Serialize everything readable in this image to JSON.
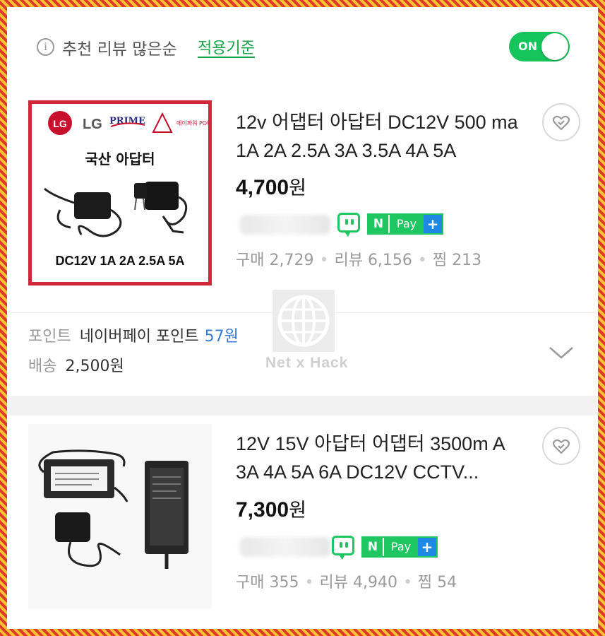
{
  "filter": {
    "info_icon": "info-icon",
    "sort_label": "추천 리뷰 많은순",
    "criteria_link": "적용기준",
    "toggle_label": "ON",
    "toggle_on": true
  },
  "products": [
    {
      "title": "12v 어댑터 아답터 DC12V 500 ma 1A 2A 2.5A 3A 3.5A 4A 5A",
      "price": "4,700",
      "currency": "원",
      "badges": {
        "npay_n": "N",
        "npay_pay": "Pay",
        "npay_plus": "+"
      },
      "stats": {
        "purchase_label": "구매",
        "purchase": "2,729",
        "review_label": "리뷰",
        "review": "6,156",
        "wish_label": "찜",
        "wish": "213"
      },
      "image": {
        "brand_lg": "LG",
        "brand_prime": "PRIME",
        "brand_power": "에이파워 POWER",
        "heading": "국산 아답터",
        "caption": "DC12V 1A 2A 2.5A 5A"
      },
      "point_label": "포인트",
      "point_value": "네이버페이 포인트",
      "point_amount": "57원",
      "shipping_label": "배송",
      "shipping_value": "2,500원"
    },
    {
      "title": "12V 15V 아답터 어댑터 3500m A 3A 4A 5A 6A DC12V CCTV...",
      "price": "7,300",
      "currency": "원",
      "badges": {
        "npay_n": "N",
        "npay_pay": "Pay",
        "npay_plus": "+"
      },
      "stats": {
        "purchase_label": "구매",
        "purchase": "355",
        "review_label": "리뷰",
        "review": "4,940",
        "wish_label": "찜",
        "wish": "54"
      }
    }
  ],
  "watermark": "Net x Hack",
  "colors": {
    "green": "#1ec761",
    "link_green": "#1aa549",
    "blue": "#3a7bd5",
    "red_frame": "#d0283a"
  }
}
